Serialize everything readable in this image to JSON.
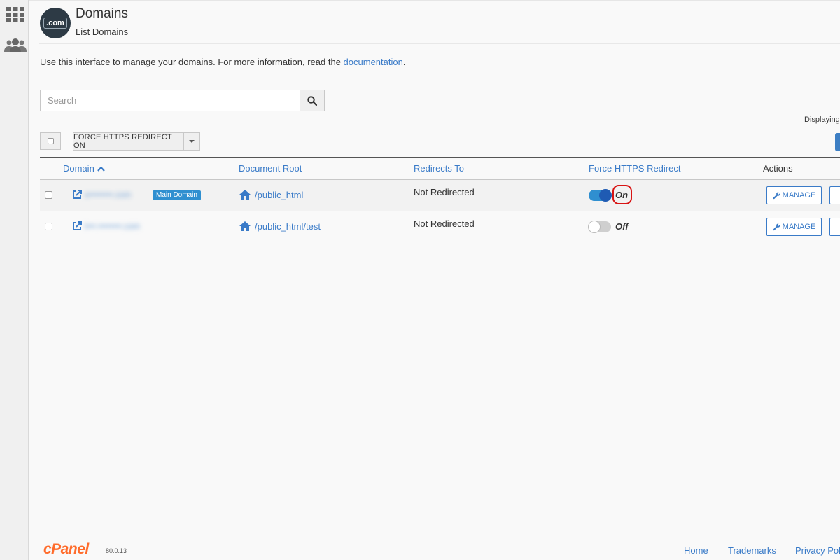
{
  "sidebar": {
    "icons": [
      {
        "name": "apps-grid-icon"
      },
      {
        "name": "users-icon"
      }
    ]
  },
  "header": {
    "logo_text": ".com",
    "title": "Domains",
    "subtitle": "List Domains"
  },
  "intro": {
    "text": "Use this interface to manage your domains. For more information, read the ",
    "link": "documentation",
    "suffix": "."
  },
  "search": {
    "placeholder": "Search",
    "value": ""
  },
  "toolbar": {
    "bulk_action_label": "FORCE HTTPS REDIRECT ON",
    "displaying_label": "Displaying"
  },
  "table": {
    "columns": [
      "Domain",
      "Document Root",
      "Redirects To",
      "Force HTTPS Redirect",
      "Actions"
    ],
    "rows": [
      {
        "domain": "e••••••••.com",
        "badge": "Main Domain",
        "document_root": "/public_html",
        "redirects_to": "Not Redirected",
        "force_https": "On",
        "action_label": "MANAGE"
      },
      {
        "domain": "t•••.••••••••.com",
        "badge": "",
        "document_root": "/public_html/test",
        "redirects_to": "Not Redirected",
        "force_https": "Off",
        "action_label": "MANAGE"
      }
    ]
  },
  "footer": {
    "brand": "cPanel",
    "version": "80.0.13",
    "links": [
      "Home",
      "Trademarks",
      "Privacy Pol"
    ]
  },
  "colors": {
    "link": "#3a7bc8",
    "toggle_on": "#2f8fd0",
    "badge": "#2f8fd0",
    "highlight": "#d81414",
    "brand": "#ff6c2c"
  }
}
